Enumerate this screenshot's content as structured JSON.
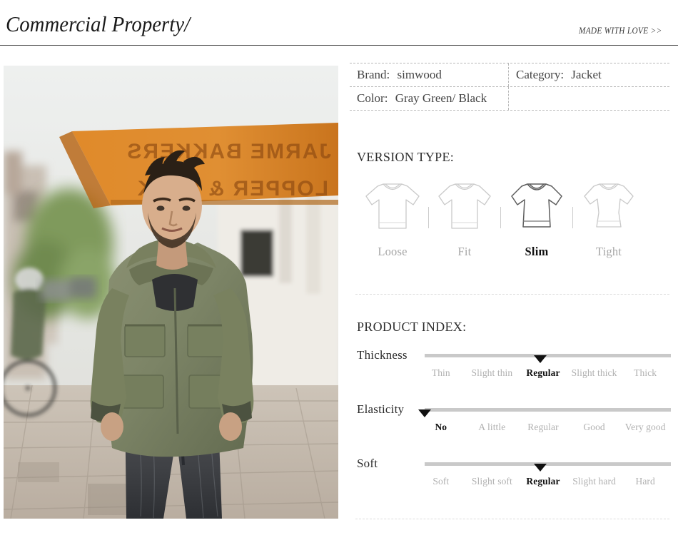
{
  "header": {
    "title": "Commercial Property/",
    "tagline": "MADE WITH LOVE >>"
  },
  "photo": {
    "alt": "Man wearing gray green jacket on a city street",
    "sign_text_1": "JARME BAKKERS",
    "sign_text_2": "LOPPER & SLAK"
  },
  "spec_table": {
    "rows": [
      {
        "left": {
          "key": "Brand:",
          "value": "simwood"
        },
        "right": {
          "key": "Category:",
          "value": "Jacket"
        }
      },
      {
        "left": {
          "key": "Color:",
          "value": "Gray Green/ Black"
        },
        "right": {
          "key": "",
          "value": ""
        }
      }
    ]
  },
  "version_type": {
    "heading": "VERSION TYPE:",
    "options": [
      {
        "label": "Loose",
        "selected": false,
        "icon": "tshirt-loose-icon"
      },
      {
        "label": "Fit",
        "selected": false,
        "icon": "tshirt-fit-icon"
      },
      {
        "label": "Slim",
        "selected": true,
        "icon": "tshirt-slim-icon"
      },
      {
        "label": "Tight",
        "selected": false,
        "icon": "tshirt-tight-icon"
      }
    ]
  },
  "product_index": {
    "heading": "PRODUCT INDEX:",
    "sliders": [
      {
        "name": "Thickness",
        "scale": [
          "Thin",
          "Slight thin",
          "Regular",
          "Slight thick",
          "Thick"
        ],
        "selected_index": 2,
        "selected_value": "Regular",
        "marker_percent": 47
      },
      {
        "name": "Elasticity",
        "scale": [
          "No",
          "A little",
          "Regular",
          "Good",
          "Very good"
        ],
        "selected_index": 0,
        "selected_value": "No",
        "marker_percent": 0
      },
      {
        "name": "Soft",
        "scale": [
          "Soft",
          "Slight soft",
          "Regular",
          "Slight hard",
          "Hard"
        ],
        "selected_index": 2,
        "selected_value": "Regular",
        "marker_percent": 47
      }
    ]
  },
  "colors": {
    "rule": "#4a4a4a",
    "dashed_border": "#b9b9b9",
    "track": "#c9c9c9",
    "marker": "#111111",
    "muted_text": "#b0b0b0",
    "active_text": "#111111"
  }
}
